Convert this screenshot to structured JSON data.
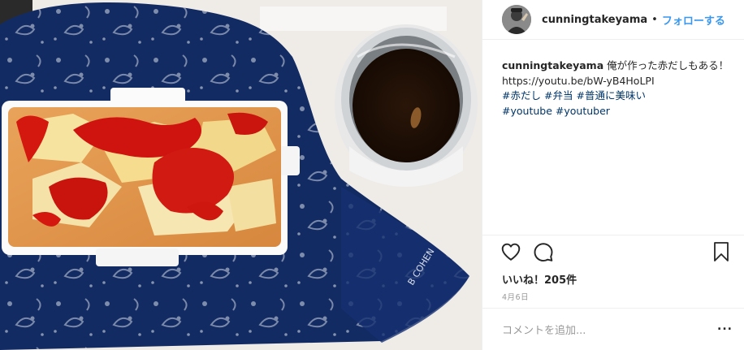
{
  "post": {
    "author": "cunningtakeyama",
    "separator": "•",
    "follow_label": "フォローする",
    "caption": {
      "username": "cunningtakeyama",
      "text": "俺が作った赤だしもある！",
      "link": "https://youtu.be/bW-yB4HoLPI",
      "hashtags": [
        "#赤だし",
        "#弁当",
        "#普通に美味い",
        "#youtube",
        "#youtuber"
      ]
    },
    "likes_label": "いいね！205件",
    "date_label": "4月6日",
    "comment_placeholder": "コメントを追加...",
    "more_label": "..."
  },
  "photo": {
    "bandana_text": "B COHEN"
  },
  "colors": {
    "link_blue": "#3897f0",
    "hashtag_blue": "#003569",
    "text": "#262626",
    "muted": "#999999",
    "border": "#efefef"
  },
  "icons": {
    "like": "heart-outline-icon",
    "comment": "speech-bubble-icon",
    "save": "bookmark-icon",
    "more": "ellipsis-icon"
  }
}
